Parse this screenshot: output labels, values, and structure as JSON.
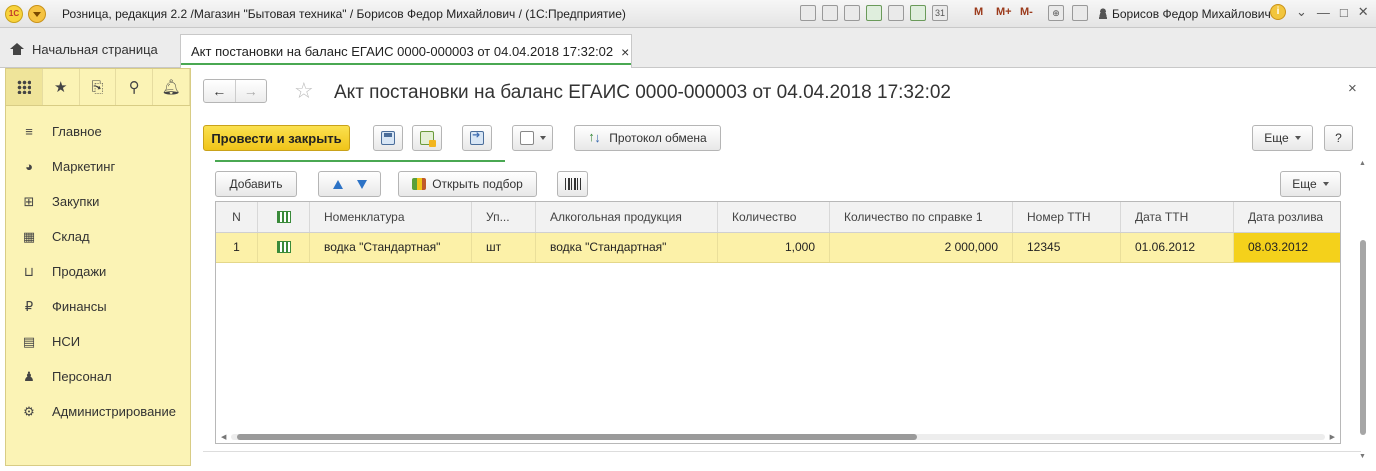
{
  "titlebar": {
    "title": "Розница, редакция 2.2 /Магазин \"Бытовая техника\" / Борисов Федор Михайлович /  (1С:Предприятие)",
    "logo": "1С",
    "memory_buttons": [
      "M",
      "M+",
      "M-"
    ],
    "user": "Борисов Федор Михайлович",
    "info_icon": "i",
    "icons": [
      "save-icon",
      "print-icon",
      "preview-icon",
      "favorite-add-icon",
      "history-icon",
      "calculator-icon",
      "calendar-icon",
      "zoom-icon",
      "panel-icon"
    ],
    "calendar_day": "31"
  },
  "tabs": {
    "home_label": "Начальная страница",
    "doc_label": "Акт постановки на баланс ЕГАИС 0000-000003 от 04.04.2018 17:32:02",
    "close": "×"
  },
  "sidebar": {
    "items": [
      {
        "label": "Главное",
        "icon": "menu-icon",
        "glyph": "≡"
      },
      {
        "label": "Маркетинг",
        "icon": "pie-chart-icon",
        "glyph": "◕"
      },
      {
        "label": "Закупки",
        "icon": "cart-icon",
        "glyph": "⊞"
      },
      {
        "label": "Склад",
        "icon": "warehouse-icon",
        "glyph": "▦"
      },
      {
        "label": "Продажи",
        "icon": "basket-icon",
        "glyph": "⊔"
      },
      {
        "label": "Финансы",
        "icon": "ruble-icon",
        "glyph": "₽"
      },
      {
        "label": "НСИ",
        "icon": "catalog-icon",
        "glyph": "▤"
      },
      {
        "label": "Персонал",
        "icon": "person-icon",
        "glyph": "♟"
      },
      {
        "label": "Администрирование",
        "icon": "gear-icon",
        "glyph": "⚙"
      }
    ]
  },
  "form": {
    "title": "Акт постановки на баланс ЕГАИС 0000-000003 от 04.04.2018 17:32:02",
    "nav_back": "←",
    "nav_forward": "→",
    "star": "☆",
    "close": "×",
    "post_and_close": "Провести и закрыть",
    "exchange_log": "Протокол обмена",
    "more": "Еще",
    "help": "?"
  },
  "table_toolbar": {
    "add": "Добавить",
    "open_selection": "Открыть подбор",
    "more": "Еще"
  },
  "table": {
    "headers": [
      "N",
      "",
      "Номенклатура",
      "Уп...",
      "Алкогольная продукция",
      "Количество",
      "Количество по справке 1",
      "Номер ТТН",
      "Дата ТТН",
      "Дата розлива"
    ],
    "rows": [
      {
        "n": "1",
        "nomenclature": "водка \"Стандартная\"",
        "unit": "шт",
        "alcohol": "водка \"Стандартная\"",
        "qty": "1,000",
        "qty_cert": "2 000,000",
        "ttn": "12345",
        "ttn_date": "01.06.2012",
        "bottling_date": "08.03.2012"
      }
    ]
  },
  "colors": {
    "accent_green": "#4aa852",
    "primary_button": "#f0c419",
    "selected_row": "#fcf1a8",
    "sidebar": "#fbf3b5"
  }
}
